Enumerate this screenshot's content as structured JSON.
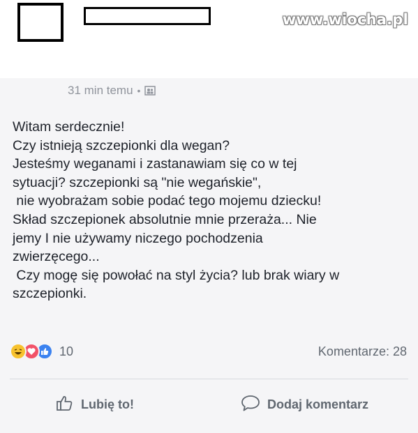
{
  "watermark": "www.wiocha.pl",
  "post": {
    "timestamp": "31 min temu",
    "separator": "•",
    "privacy_icon": "friends-icon",
    "lines": [
      "Witam serdecznie!",
      "Czy istnieją szczepionki dla wegan?",
      "Jesteśmy weganami i zastanawiam się co w tej",
      "sytuacji? szczepionki są \"nie wegańskie\",",
      " nie wyobrażam sobie podać tego mojemu dziecku!",
      "Skład szczepionek absolutnie mnie przeraża... Nie",
      "jemy I nie używamy niczego pochodzenia",
      "zwierzęcego...",
      " Czy mogę się powołać na styl życia? lub brak wiary w",
      "szczepionki."
    ]
  },
  "reactions": {
    "icons": [
      "haha-icon",
      "love-icon",
      "like-icon"
    ],
    "count": "10"
  },
  "comments": {
    "label": "Komentarze: 28"
  },
  "actions": {
    "like_label": "Lubię to!",
    "comment_label": "Dodaj komentarz"
  },
  "colors": {
    "text": "#1d2129",
    "muted": "#606770",
    "meta": "#90949c",
    "haha": "#f7c22e",
    "love": "#f25268",
    "like": "#3b82f0"
  }
}
